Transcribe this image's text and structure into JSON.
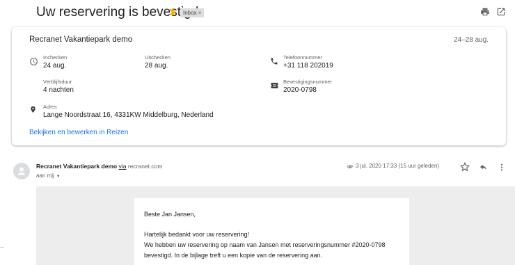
{
  "header": {
    "subject": "Uw reservering is bevestigd",
    "label_chip": "Inbox",
    "label_chip_close": "×",
    "icons": [
      "importance-marker-icon",
      "print-icon",
      "open-in-new-window-icon"
    ]
  },
  "card": {
    "title": "Recranet Vakantiepark demo",
    "date_range": "24–28 aug.",
    "checkin_label": "Inchecken",
    "checkin_value": "24 aug.",
    "checkout_label": "Uitchecken",
    "checkout_value": "28 aug.",
    "phone_label": "Telefoonnummer",
    "phone_value": "+31 118 202019",
    "duration_label": "Verblijfsduur",
    "duration_value": "4 nachten",
    "confirmation_label": "Bevestigingsnummer",
    "confirmation_value": "2020-0798",
    "address_label": "Adres",
    "address_value": "Lange Noordstraat 16, 4331KW Middelburg, Nederland",
    "link": "Bekijken en bewerken in Reizen"
  },
  "message": {
    "sender_name": "Recranet Vakantiepark demo",
    "via_label": "via",
    "sender_domain": "recranet.com",
    "to_label": "aan mij",
    "date": "3 jul. 2020 17:33 (15 uur geleden)"
  },
  "mail_body": {
    "greeting": "Beste Jan Jansen,",
    "line1": "Hartelijk bedankt voor uw reservering!",
    "line2": "We hebben uw reservering op naam van Jansen met reserveringsnummer #2020-0798",
    "line3": "bevestigd. In de bijlage treft u een kopie van de reservering aan."
  },
  "colors": {
    "link": "#1a73e8",
    "importance": "#f4b400",
    "text": "#202124",
    "secondary_text": "#5f6368",
    "body_background": "#ededed"
  }
}
